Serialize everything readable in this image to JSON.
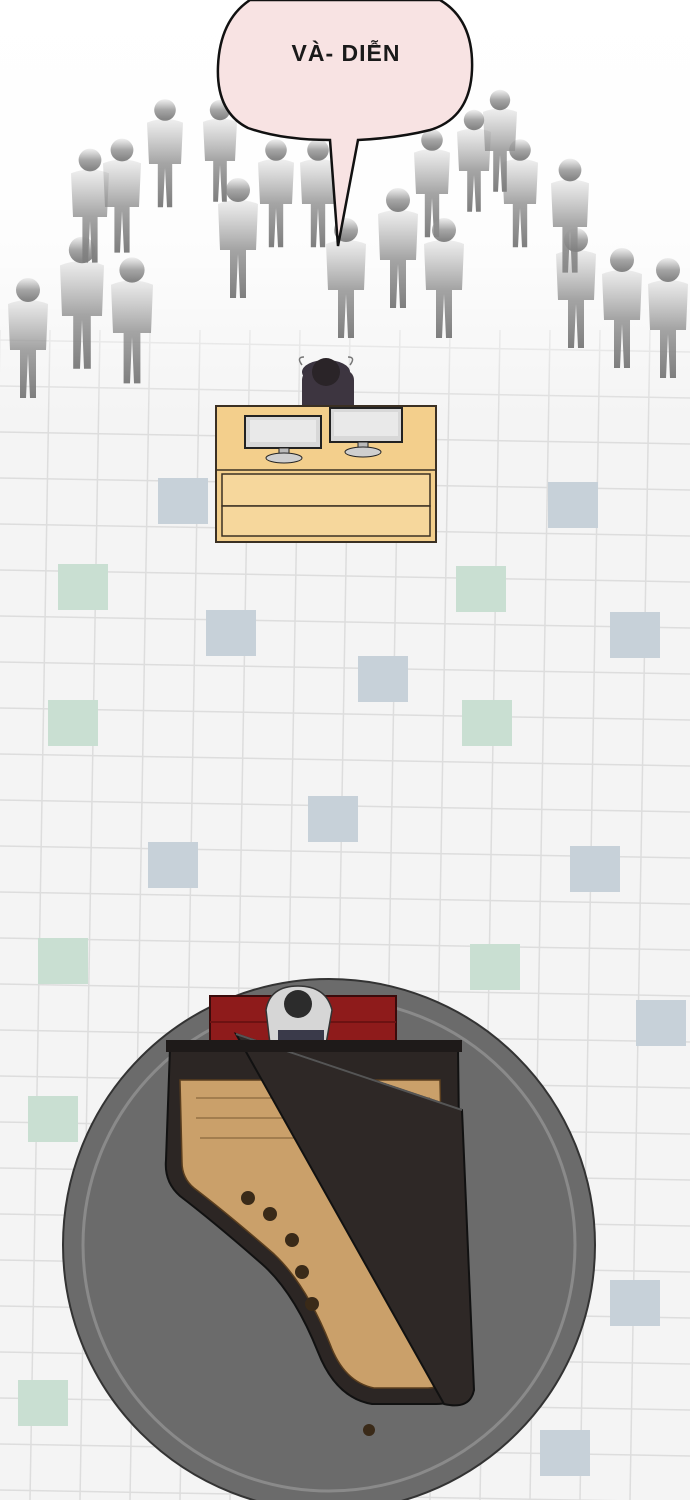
{
  "panel": {
    "speech_bubble": {
      "text": "VÀ- DIỄN",
      "fill_color": "#f8e3e3",
      "stroke_color": "#111111"
    },
    "scene_elements": {
      "floor_tile_colors": [
        "#ffffff",
        "#c7d1d9",
        "#c9dfd2"
      ],
      "crowd_color": "#9a9a9a",
      "desk_color": "#f3cf8c",
      "piano_color": "#2c2624",
      "piano_interior_color": "#caa06a",
      "rug_color": "#6a6a6a",
      "bench_color": "#8e1b1b"
    }
  }
}
